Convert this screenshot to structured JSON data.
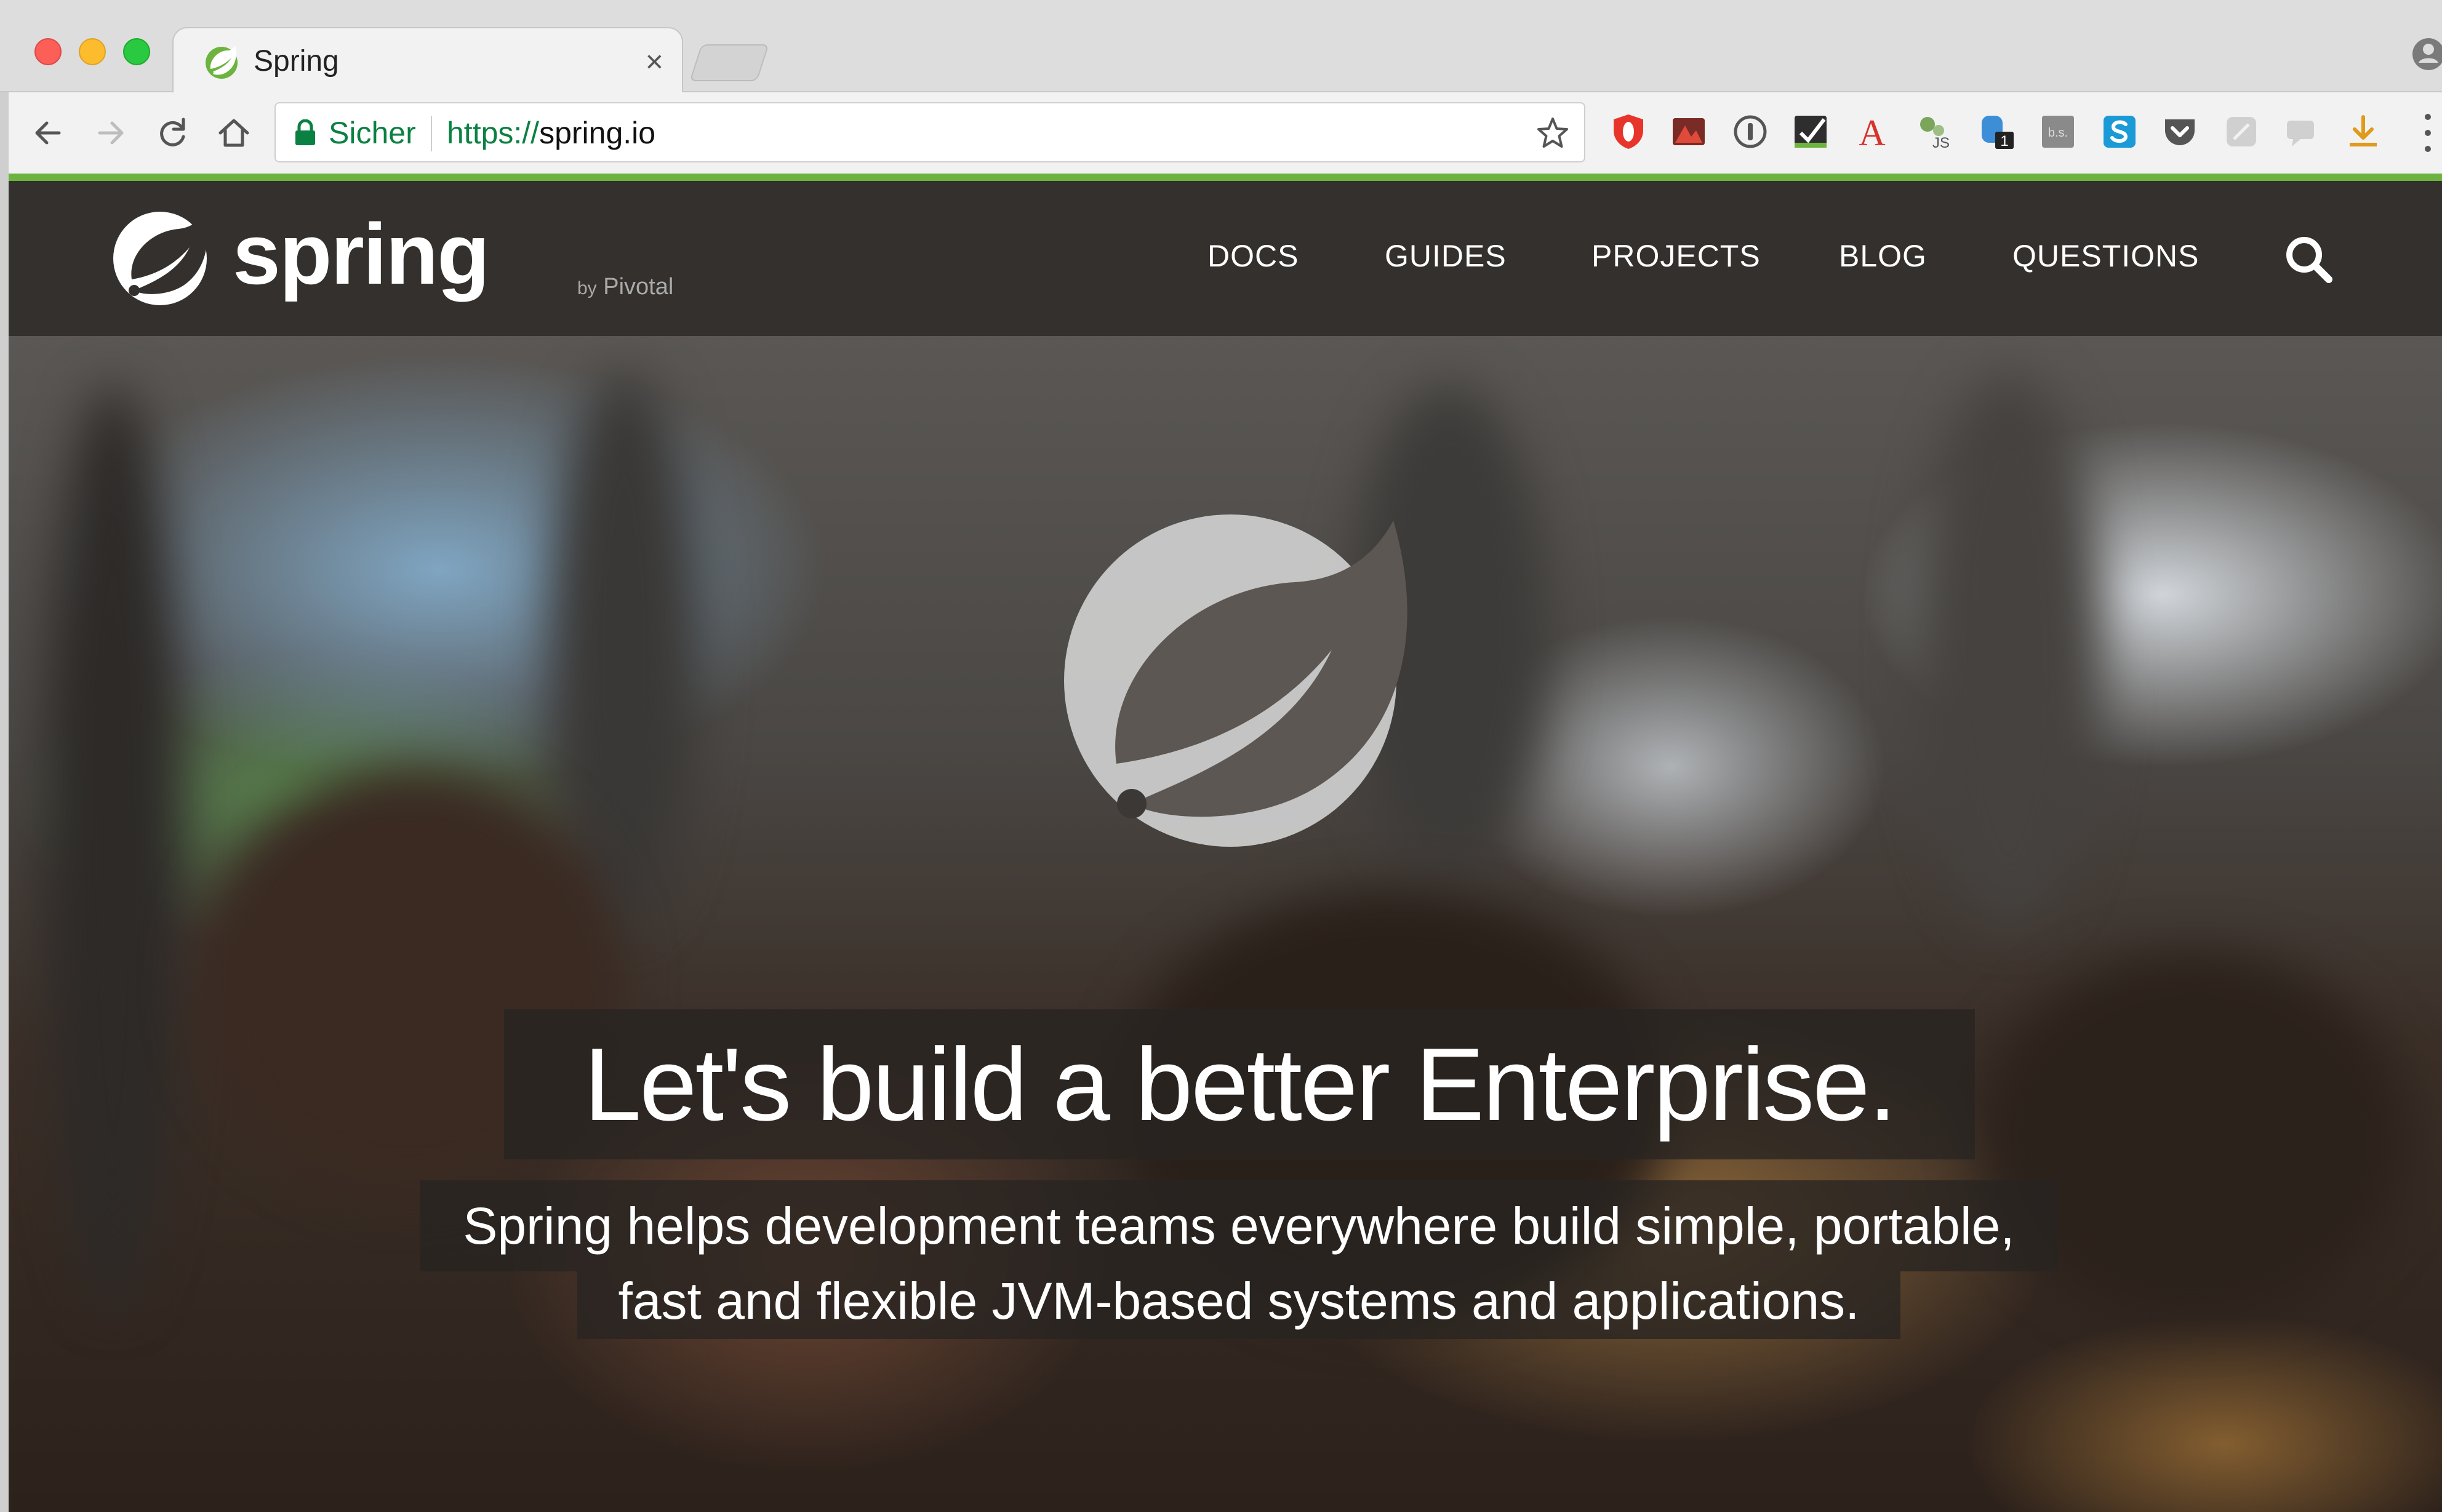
{
  "browser": {
    "tab_title": "Spring",
    "tab_close": "×",
    "security_label": "Sicher",
    "url_scheme": "https://",
    "url_host": "spring.io",
    "extensions": [
      {
        "name": "opera-shield-icon",
        "color": "#e8352b"
      },
      {
        "name": "screen-record-icon",
        "color": "#c0392b"
      },
      {
        "name": "info-circle-icon",
        "color": "#555555"
      },
      {
        "name": "checkbox-check-icon",
        "color": "#333333"
      },
      {
        "name": "letter-a-icon",
        "color": "#d6332b"
      },
      {
        "name": "js-gears-icon",
        "color": "#7aa55a"
      },
      {
        "name": "badge-extension-icon",
        "color": "#3c8fd6"
      },
      {
        "name": "bs-icon",
        "color": "#8a8a8a"
      },
      {
        "name": "skype-s-icon",
        "color": "#1a9ad6"
      },
      {
        "name": "pocket-icon",
        "color": "#555555"
      },
      {
        "name": "disabled-extension-icon",
        "color": "#cccccc"
      },
      {
        "name": "comment-extension-icon",
        "color": "#cccccc"
      },
      {
        "name": "download-icon",
        "color": "#e09a1c"
      }
    ],
    "badge_count": "1",
    "bs_label": "b.s.",
    "js_label": "JS",
    "a_label": "A"
  },
  "site": {
    "brand_word": "spring",
    "brand_by": "by",
    "brand_company": "Pivotal",
    "nav": {
      "docs": "DOCS",
      "guides": "GUIDES",
      "projects": "PROJECTS",
      "blog": "BLOG",
      "questions": "QUESTIONS"
    },
    "accent_color": "#6db33f",
    "header_color": "#34302d"
  },
  "hero": {
    "title": "Let's build a better Enterprise.",
    "subtitle_line1": "Spring helps development teams everywhere build simple, portable,",
    "subtitle_line2": "fast and flexible JVM-based systems and applications."
  }
}
